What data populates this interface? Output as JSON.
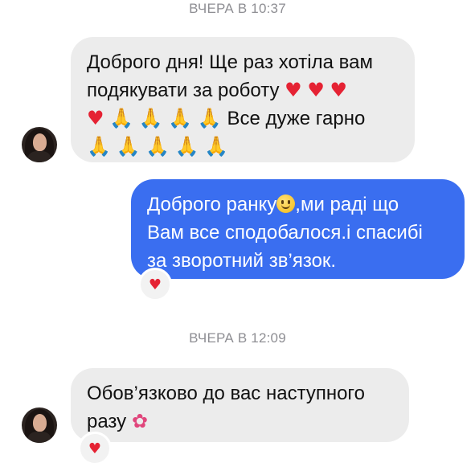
{
  "messages": [
    {
      "timestamp": "ВЧЕРА В 10:37",
      "incoming_1": {
        "line1": "Доброго дня! Ще раз хотіла вам",
        "line2_text": "подякувати за роботу",
        "line3_text": "Все дуже гарно"
      },
      "outgoing_1": {
        "line1_a": "Доброго ранку",
        "line1_b": ",ми раді що",
        "line2": "Вам все сподобалося.і спасибі",
        "line3": "за зворотний зв’язок."
      }
    },
    {
      "timestamp": "ВЧЕРА В 12:09",
      "incoming_2": {
        "line1": "Обов’язково до вас наступного",
        "line2_text": "разу"
      }
    }
  ],
  "emoji": {
    "heart": "♥",
    "pray": "🙏",
    "flower": "✿"
  },
  "reactions": {
    "outgoing_1": "♥",
    "incoming_2": "♥"
  },
  "colors": {
    "incoming_bubble": "#ececec",
    "outgoing_bubble": "#3a6ef0",
    "heart": "#e52233",
    "timestamp": "#8e8e93"
  }
}
